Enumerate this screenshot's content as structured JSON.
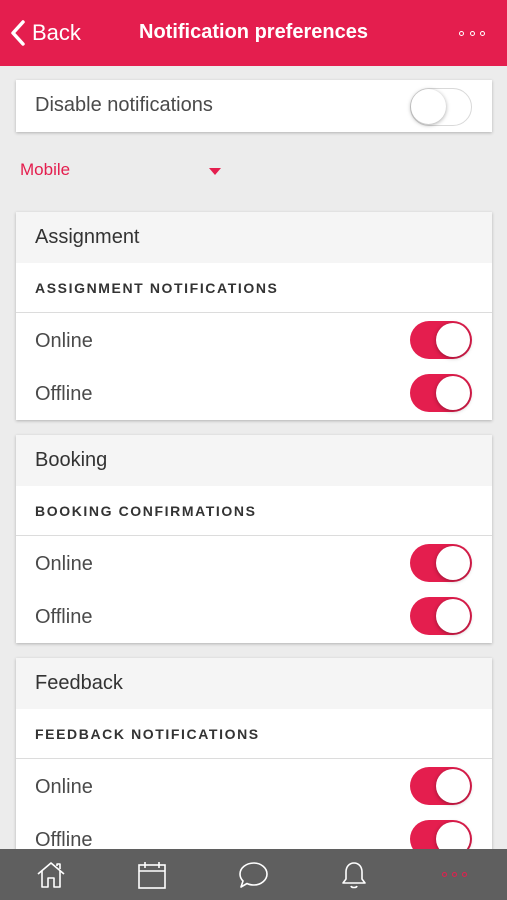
{
  "header": {
    "back_label": "Back",
    "title": "Notification preferences",
    "more_icon": "more-horizontal-icon"
  },
  "disable": {
    "label": "Disable notifications",
    "enabled": false
  },
  "platform": {
    "selected": "Mobile"
  },
  "sections": [
    {
      "title": "Assignment",
      "subtitle": "ASSIGNMENT NOTIFICATIONS",
      "rows": [
        {
          "label": "Online",
          "enabled": true
        },
        {
          "label": "Offline",
          "enabled": true
        }
      ]
    },
    {
      "title": "Booking",
      "subtitle": "BOOKING CONFIRMATIONS",
      "rows": [
        {
          "label": "Online",
          "enabled": true
        },
        {
          "label": "Offline",
          "enabled": true
        }
      ]
    },
    {
      "title": "Feedback",
      "subtitle": "FEEDBACK NOTIFICATIONS",
      "rows": [
        {
          "label": "Online",
          "enabled": true
        },
        {
          "label": "Offline",
          "enabled": true
        }
      ]
    }
  ],
  "tabbar": {
    "items": [
      "home-icon",
      "calendar-icon",
      "chat-icon",
      "bell-icon",
      "more-icon"
    ],
    "active_index": 4
  },
  "colors": {
    "accent": "#e41e4e",
    "tabbar": "#5f5f5f",
    "background": "#ececec"
  }
}
